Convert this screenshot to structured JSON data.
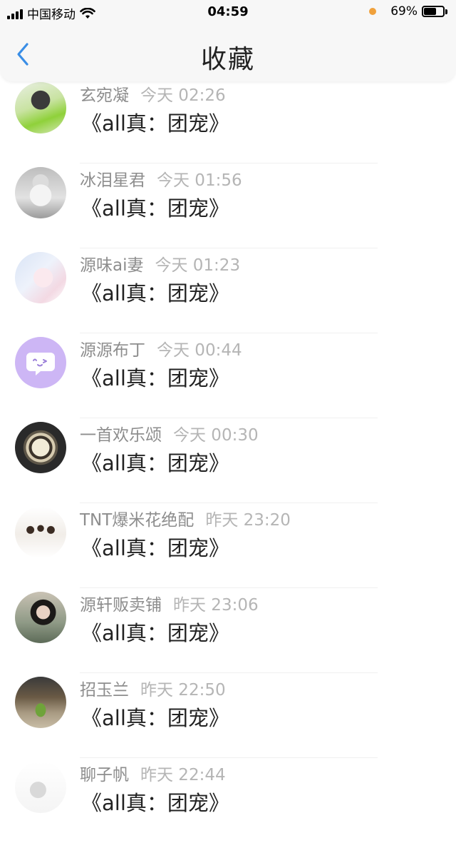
{
  "status_bar": {
    "carrier": "中国移动",
    "time": "04:59",
    "battery": "69%",
    "battery_level": 0.69
  },
  "header": {
    "title": "收藏",
    "back_icon": "chevron-left-icon"
  },
  "list": [
    {
      "username": "玄宛凝",
      "time": "今天 02:26",
      "content": "《all真：团宠》"
    },
    {
      "username": "冰泪星君",
      "time": "今天 01:56",
      "content": "《all真：团宠》"
    },
    {
      "username": "源味ai妻",
      "time": "今天 01:23",
      "content": "《all真：团宠》"
    },
    {
      "username": "源源布丁",
      "time": "今天 00:44",
      "content": "《all真：团宠》"
    },
    {
      "username": "一首欢乐颂",
      "time": "今天 00:30",
      "content": "《all真：团宠》"
    },
    {
      "username": "TNT爆米花绝配",
      "time": "昨天 23:20",
      "content": "《all真：团宠》"
    },
    {
      "username": "源轩贩卖铺",
      "time": "昨天 23:06",
      "content": "《all真：团宠》"
    },
    {
      "username": "招玉兰",
      "time": "昨天 22:50",
      "content": "《all真：团宠》"
    },
    {
      "username": "聊子帆",
      "time": "昨天 22:44",
      "content": "《all真：团宠》"
    }
  ],
  "colors": {
    "accent": "#3a8ee6",
    "username": "#8d8d8d",
    "timestamp": "#b5b5b5",
    "content": "#222222"
  }
}
